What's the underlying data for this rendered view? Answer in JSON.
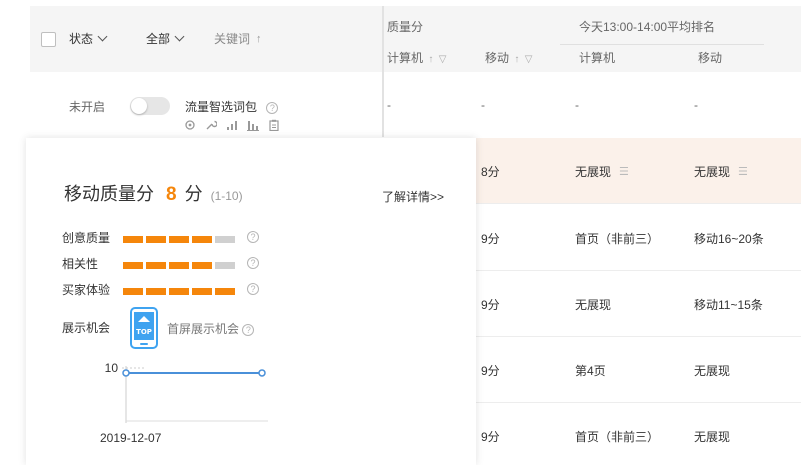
{
  "header": {
    "status_label": "状态",
    "filter_label": "全部",
    "keyword_label": "关键词",
    "quality_group": "质量分",
    "rank_group": "今天13:00-14:00平均排名",
    "cols": {
      "q_pc": "计算机",
      "q_mobile": "移动",
      "r_pc": "计算机",
      "r_mobile": "移动"
    }
  },
  "row1": {
    "status": "未开启",
    "keyword": "流量智选词包",
    "cells": [
      "-",
      "-",
      "-",
      "-"
    ]
  },
  "data_rows": [
    {
      "score": "8分",
      "pc": "无展现",
      "mobile": "无展现",
      "highlight": true
    },
    {
      "score": "9分",
      "pc": "首页（非前三）",
      "mobile": "移动16~20条",
      "highlight": false
    },
    {
      "score": "9分",
      "pc": "无展现",
      "mobile": "移动11~15条",
      "highlight": false
    },
    {
      "score": "9分",
      "pc": "第4页",
      "mobile": "无展现",
      "highlight": false
    },
    {
      "score": "9分",
      "pc": "首页（非前三）",
      "mobile": "无展现",
      "highlight": false
    }
  ],
  "popup": {
    "title": "移动质量分",
    "score": "8",
    "unit": "分",
    "range": "(1-10)",
    "link": "了解详情>>",
    "metrics": [
      {
        "label": "创意质量",
        "level": 4,
        "max": 5
      },
      {
        "label": "相关性",
        "level": 4,
        "max": 5
      },
      {
        "label": "买家体验",
        "level": 5,
        "max": 5
      }
    ],
    "show_label": "展示机会",
    "show_text": "首屏展示机会",
    "phone_badge": "TOP",
    "colors": {
      "filled": "#f5860b",
      "empty": "#d0d0d0",
      "line": "#4a90d9",
      "phone": "#3fa3f0"
    }
  },
  "chart_data": {
    "type": "line",
    "x": [
      "",
      "2019-12-07"
    ],
    "series": [
      {
        "values": [
          8,
          8
        ]
      }
    ],
    "yticks": [
      10
    ],
    "xlabel_shown": "2019-12-07"
  }
}
